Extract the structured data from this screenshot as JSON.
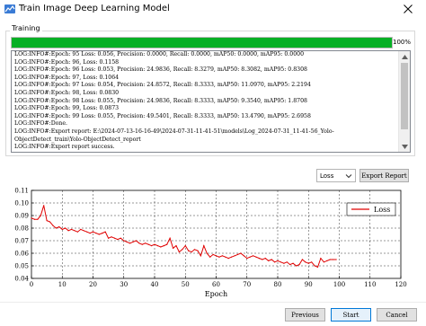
{
  "window": {
    "title": "Train Image Deep Learning Model",
    "close_glyph": "✕",
    "icon": "app-icon"
  },
  "training": {
    "group_label": "Training",
    "progress_percent": 100,
    "progress_text": "100%",
    "progress_color": "#06b025"
  },
  "log": {
    "lines": [
      "LOG:INFO#:Epoch: 95 Loss: 0.056, Precision: 0.0000, Recall: 0.0000, mAP50: 0.0000, mAP95: 0.0000",
      "LOG:INFO#:Epoch: 96, Loss: 0.1158",
      "LOG:INFO#:Epoch: 96 Loss: 0.053, Precision: 24.9836, Recall: 8.3279, mAP50: 8.3082, mAP95: 0.8308",
      "LOG:INFO#:Epoch: 97, Loss: 0.1064",
      "LOG:INFO#:Epoch: 97 Loss: 0.054, Precision: 24.8572, Recall: 8.3333, mAP50: 11.0970, mAP95: 2.2194",
      "LOG:INFO#:Epoch: 98, Loss: 0.0830",
      "LOG:INFO#:Epoch: 98 Loss: 0.055, Precision: 24.9836, Recall: 8.3333, mAP50: 9.3540, mAP95: 1.8708",
      "LOG:INFO#:Epoch: 99, Loss: 0.0873",
      "LOG:INFO#:Epoch: 99 Loss: 0.055, Precision: 49.5401, Recall: 8.3333, mAP50: 13.4790, mAP95: 2.6958",
      "LOG:INFO#:Done.",
      "LOG:INFO#:Export report: E:\\2024-07-13-16-16-49\\2024-07-31-11-41-51\\models\\Log_2024-07-31_11-41-56_Yolo-",
      "ObjectDetect_train\\Yolo-ObjectDetect_report",
      "LOG:INFO#:Export report success."
    ]
  },
  "controls": {
    "metric_select_value": "Loss",
    "export_report_label": "Export Report"
  },
  "footer": {
    "previous_label": "Previous",
    "start_label": "Start",
    "cancel_label": "Cancel"
  },
  "chart_data": {
    "type": "line",
    "xlabel": "Epoch",
    "ylabel": "",
    "xlim": [
      0,
      120
    ],
    "ylim": [
      0.04,
      0.11
    ],
    "x_ticks": [
      "0",
      "10",
      "20",
      "30",
      "40",
      "50",
      "60",
      "70",
      "80",
      "90",
      "100",
      "110",
      "120"
    ],
    "y_ticks": [
      "0.04",
      "0.05",
      "0.06",
      "0.07",
      "0.08",
      "0.09",
      "0.10",
      "0.11"
    ],
    "grid": true,
    "legend_position": "top-right",
    "series": [
      {
        "name": "Loss",
        "color": "#e00000",
        "x": [
          0,
          1,
          2,
          3,
          4,
          5,
          6,
          7,
          8,
          9,
          10,
          11,
          12,
          13,
          14,
          15,
          16,
          17,
          18,
          19,
          20,
          21,
          22,
          23,
          24,
          25,
          26,
          27,
          28,
          29,
          30,
          31,
          32,
          33,
          34,
          35,
          36,
          37,
          38,
          39,
          40,
          41,
          42,
          43,
          44,
          45,
          46,
          47,
          48,
          49,
          50,
          51,
          52,
          53,
          54,
          55,
          56,
          57,
          58,
          59,
          60,
          61,
          62,
          63,
          64,
          65,
          66,
          67,
          68,
          69,
          70,
          71,
          72,
          73,
          74,
          75,
          76,
          77,
          78,
          79,
          80,
          81,
          82,
          83,
          84,
          85,
          86,
          87,
          88,
          89,
          90,
          91,
          92,
          93,
          94,
          95,
          96,
          97,
          98,
          99
        ],
        "values": [
          0.088,
          0.087,
          0.087,
          0.09,
          0.098,
          0.086,
          0.085,
          0.082,
          0.08,
          0.081,
          0.079,
          0.08,
          0.078,
          0.079,
          0.078,
          0.077,
          0.079,
          0.078,
          0.077,
          0.076,
          0.077,
          0.076,
          0.075,
          0.076,
          0.077,
          0.072,
          0.073,
          0.072,
          0.071,
          0.072,
          0.07,
          0.069,
          0.068,
          0.069,
          0.07,
          0.068,
          0.067,
          0.068,
          0.067,
          0.066,
          0.067,
          0.066,
          0.065,
          0.066,
          0.067,
          0.072,
          0.064,
          0.066,
          0.061,
          0.063,
          0.066,
          0.062,
          0.061,
          0.063,
          0.062,
          0.058,
          0.066,
          0.06,
          0.057,
          0.059,
          0.058,
          0.057,
          0.058,
          0.057,
          0.056,
          0.057,
          0.058,
          0.059,
          0.06,
          0.058,
          0.056,
          0.057,
          0.058,
          0.057,
          0.056,
          0.055,
          0.056,
          0.054,
          0.055,
          0.053,
          0.054,
          0.053,
          0.052,
          0.053,
          0.051,
          0.052,
          0.05,
          0.051,
          0.055,
          0.053,
          0.052,
          0.053,
          0.05,
          0.049,
          0.056,
          0.053,
          0.054,
          0.055,
          0.055,
          0.055
        ]
      }
    ]
  }
}
